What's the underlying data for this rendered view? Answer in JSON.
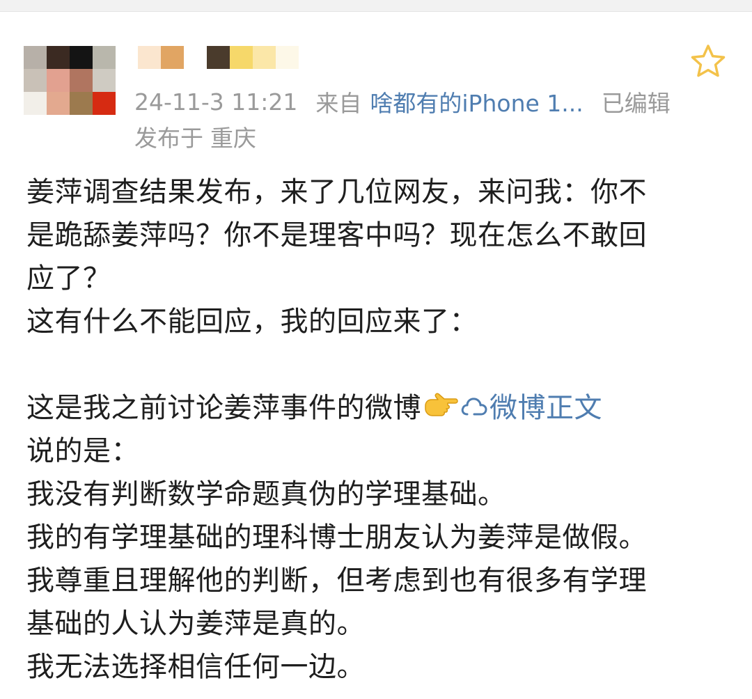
{
  "header": {
    "avatar_pixels": [
      "#b7b0a8",
      "#3b2a22",
      "#141414",
      "#b9b7ac",
      "#c9c1b7",
      "#e2a190",
      "#b07560",
      "#cfcbc2",
      "#f2efe9",
      "#e3a98f",
      "#9c7a4e",
      "#d62b12"
    ],
    "name_pixels_a": [
      "#fbe6cf",
      "#e1a563"
    ],
    "name_pixels_b": [
      "#4a3b2c",
      "#f6d86a",
      "#fbe7a8",
      "#fdf8e8"
    ],
    "timestamp": "24-11-3 11:21",
    "source_prefix": "来自",
    "source_device": "啥都有的iPhone 1...",
    "edited_label": "已编辑",
    "location_prefix": "发布于",
    "location": "重庆",
    "star_color": "#f3c24a"
  },
  "post": {
    "lines": [
      "姜萍调查结果发布，来了几位网友，来问我：你不",
      "是跪舔姜萍吗？你不是理客中吗？现在怎么不敢回",
      "应了？",
      "这有什么不能回应，我的回应来了："
    ],
    "link_line_text": "这是我之前讨论姜萍事件的微博",
    "link_label": "微博正文",
    "after_lines": [
      "说的是：",
      "我没有判断数学命题真伪的学理基础。",
      "我的有学理基础的理科博士朋友认为姜萍是做假。",
      "我尊重且理解他的判断，但考虑到也有很多有学理",
      "基础的人认为姜萍是真的。",
      "我无法选择相信任何一边。"
    ],
    "link_color": "#4f7db0"
  }
}
